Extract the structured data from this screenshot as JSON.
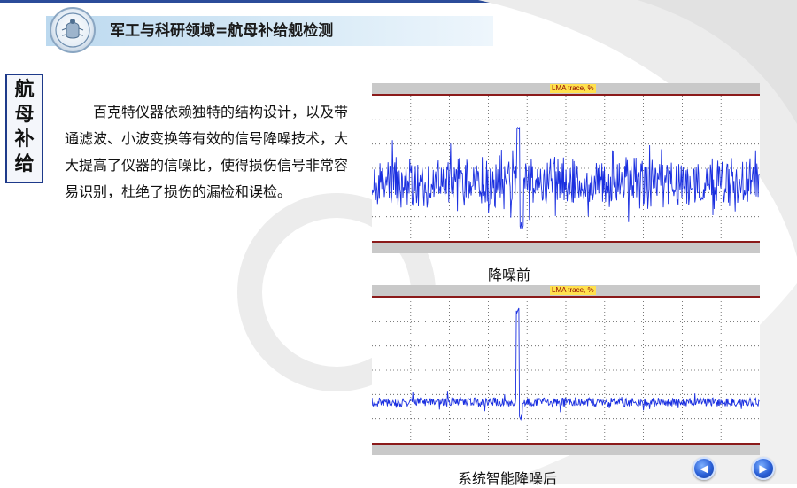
{
  "header": {
    "title": "军工与科研领域=航母补给舰检测",
    "logo_icon": "emblem-logo"
  },
  "side_tag": {
    "chars": [
      "航",
      "母",
      "补",
      "给"
    ]
  },
  "body_text": "百克特仪器依赖独特的结构设计，以及带通滤波、小波变换等有效的信号降噪技术，大大提高了仪器的信噪比，使得损伤信号非常容易识别，杜绝了损伤的漏检和误检。",
  "panels": [
    {
      "trace_label": "LMA trace, %",
      "caption": "降噪前"
    },
    {
      "trace_label": "LMA trace, %",
      "caption": "系统智能降噪后"
    }
  ],
  "nav": {
    "prev_icon": "arrow-left-icon",
    "next_icon": "arrow-right-icon",
    "prev_glyph": "◀",
    "next_glyph": "▶"
  },
  "colors": {
    "signal": "#1a2fe0",
    "frame_red": "#8b1a1a",
    "side_border": "#1e3a8a",
    "header_band": "#bcd9ef"
  }
}
